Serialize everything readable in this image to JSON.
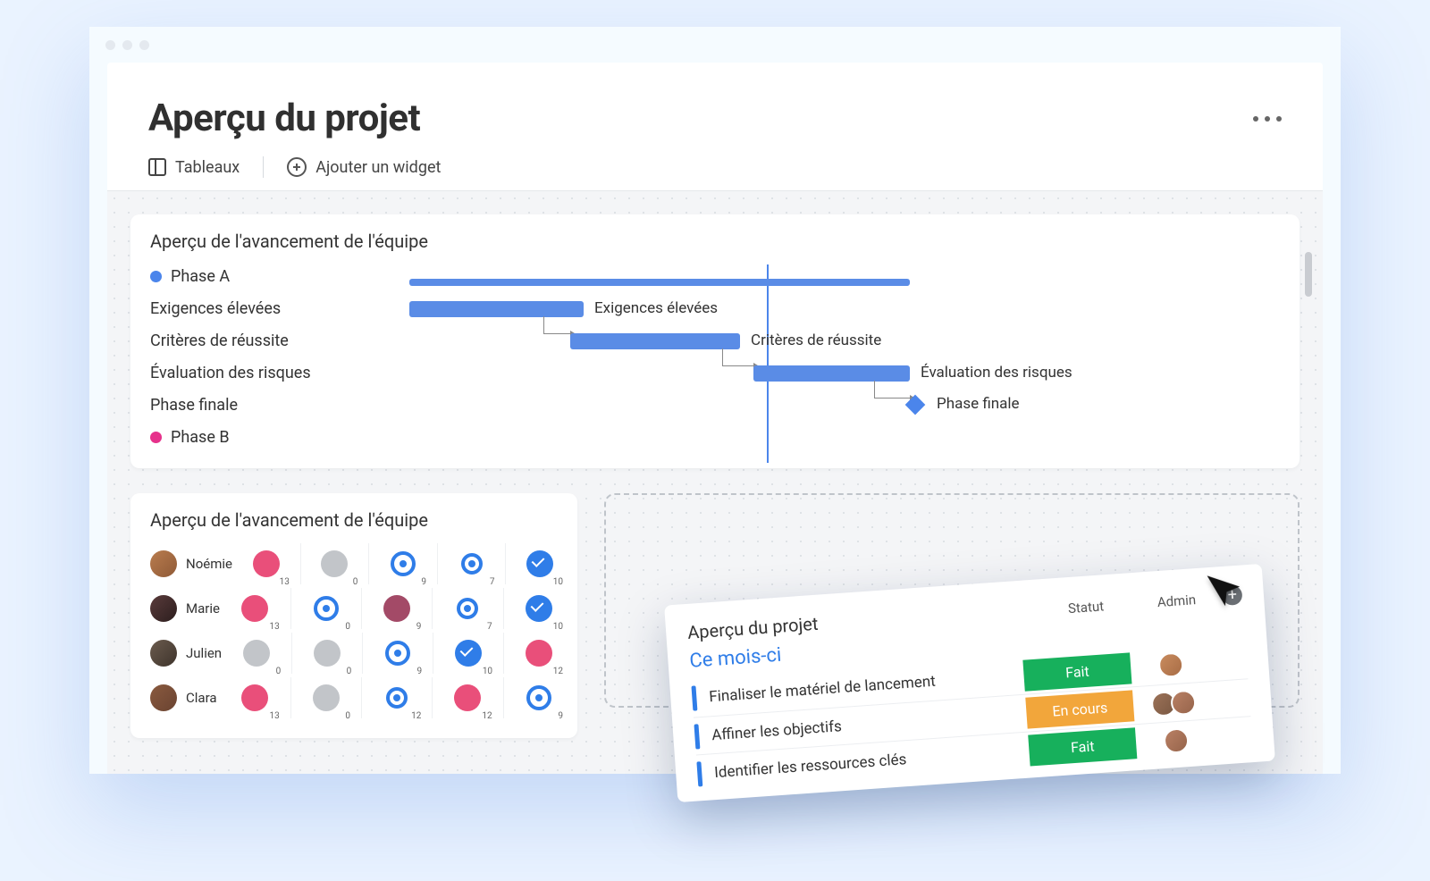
{
  "header": {
    "title": "Aperçu du projet"
  },
  "toolbar": {
    "boards_label": "Tableaux",
    "add_widget_label": "Ajouter un widget"
  },
  "gantt_card": {
    "title": "Aperçu de l'avancement de l'équipe",
    "phaseA": {
      "label": "Phase A",
      "color": "#4b85eb"
    },
    "phaseB": {
      "label": "Phase B",
      "color": "#e6318b"
    },
    "rows": [
      {
        "label": "Exigences élevées",
        "bar_label": "Exigences élevées"
      },
      {
        "label": "Critères de réussite",
        "bar_label": "Critères de réussite"
      },
      {
        "label": "Évaluation des risques",
        "bar_label": "Évaluation des risques"
      },
      {
        "label": "Phase finale",
        "bar_label": "Phase finale"
      }
    ]
  },
  "team_card": {
    "title": "Aperçu de l'avancement de l'équipe",
    "rows": [
      {
        "name": "Noémie",
        "cells": [
          {
            "color": "pink",
            "kind": "solid",
            "count": "13"
          },
          {
            "color": "grey",
            "kind": "solid",
            "count": "0"
          },
          {
            "color": "blue",
            "kind": "ring",
            "count": "9"
          },
          {
            "color": "blue",
            "kind": "ring-small",
            "count": "7"
          },
          {
            "color": "blue",
            "kind": "check",
            "count": "10"
          }
        ]
      },
      {
        "name": "Marie",
        "cells": [
          {
            "color": "pink",
            "kind": "solid",
            "count": "13"
          },
          {
            "color": "blue",
            "kind": "ring",
            "count": "0"
          },
          {
            "color": "mauve",
            "kind": "solid",
            "count": "9"
          },
          {
            "color": "blue",
            "kind": "ring-small",
            "count": "7"
          },
          {
            "color": "blue",
            "kind": "check",
            "count": "10"
          }
        ]
      },
      {
        "name": "Julien",
        "cells": [
          {
            "color": "grey",
            "kind": "solid",
            "count": "0"
          },
          {
            "color": "grey",
            "kind": "solid",
            "count": "0"
          },
          {
            "color": "blue",
            "kind": "ring",
            "count": "9"
          },
          {
            "color": "blue",
            "kind": "check",
            "count": "10"
          },
          {
            "color": "pink",
            "kind": "solid",
            "count": "12"
          }
        ]
      },
      {
        "name": "Clara",
        "cells": [
          {
            "color": "pink",
            "kind": "solid",
            "count": "13"
          },
          {
            "color": "grey",
            "kind": "solid",
            "count": "0"
          },
          {
            "color": "blue",
            "kind": "ring-small",
            "count": "12"
          },
          {
            "color": "pink",
            "kind": "solid",
            "count": "12"
          },
          {
            "color": "blue",
            "kind": "ring",
            "count": "9"
          }
        ]
      }
    ]
  },
  "overlay": {
    "title": "Aperçu du projet",
    "cols": {
      "status": "Statut",
      "admin": "Admin"
    },
    "group": "Ce mois-ci",
    "tasks": [
      {
        "name": "Finaliser le matériel de lancement",
        "status": "Fait",
        "status_class": "st-done",
        "admins": 1
      },
      {
        "name": "Affiner les objectifs",
        "status": "En cours",
        "status_class": "st-work",
        "admins": 2
      },
      {
        "name": "Identifier les ressources clés",
        "status": "Fait",
        "status_class": "st-done",
        "admins": 1
      }
    ]
  },
  "colors": {
    "blue": "#4b85eb",
    "magenta": "#e6318b",
    "green": "#17b05c",
    "orange": "#f2a63b"
  }
}
